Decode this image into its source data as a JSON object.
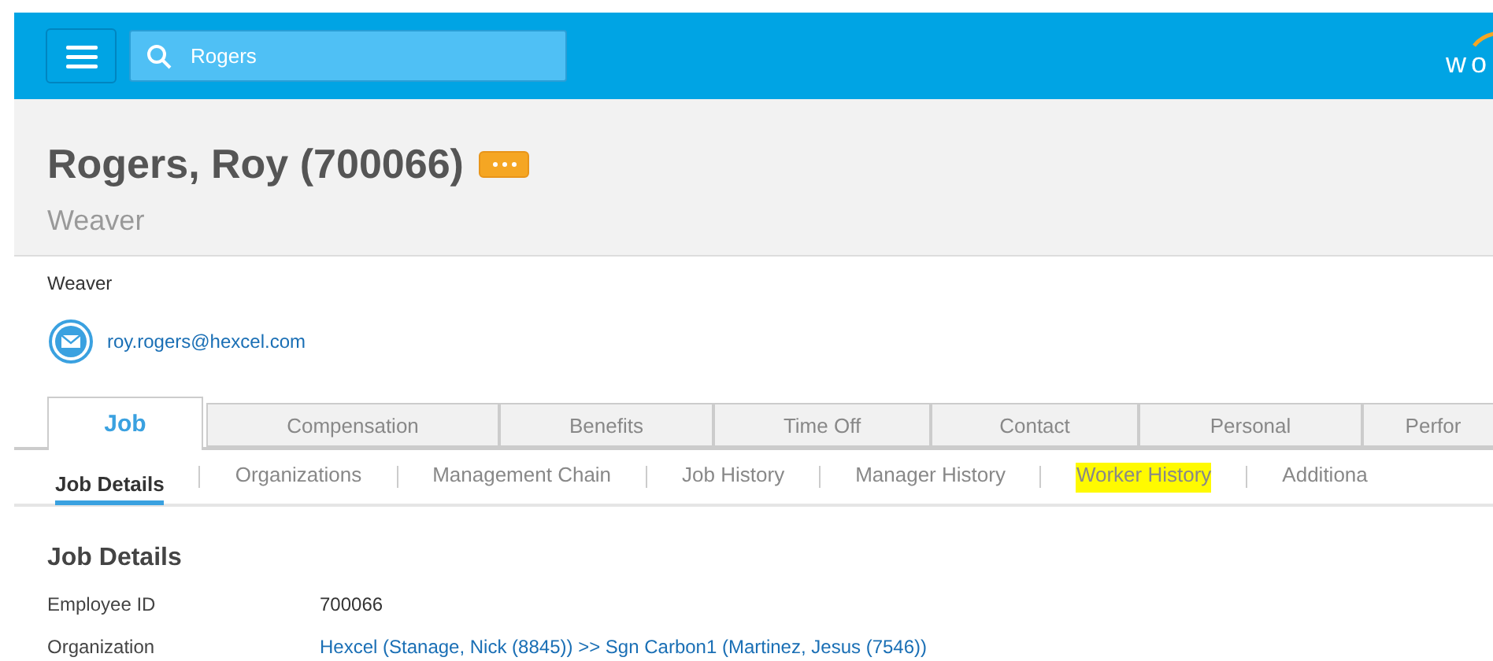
{
  "header": {
    "search": {
      "value": "Rogers"
    },
    "logo": {
      "text": "wo"
    }
  },
  "profile": {
    "name": "Rogers, Roy (700066)",
    "title": "Weaver"
  },
  "summary": {
    "position": "Weaver",
    "email": "roy.rogers@hexcel.com"
  },
  "tabs": [
    {
      "label": "Job",
      "selected": true
    },
    {
      "label": "Compensation",
      "selected": false
    },
    {
      "label": "Benefits",
      "selected": false
    },
    {
      "label": "Time Off",
      "selected": false
    },
    {
      "label": "Contact",
      "selected": false
    },
    {
      "label": "Personal",
      "selected": false
    },
    {
      "label": "Perfor",
      "selected": false
    }
  ],
  "subtabs": [
    {
      "label": "Job Details",
      "selected": true,
      "highlighted": false
    },
    {
      "label": "Organizations",
      "selected": false,
      "highlighted": false
    },
    {
      "label": "Management Chain",
      "selected": false,
      "highlighted": false
    },
    {
      "label": "Job History",
      "selected": false,
      "highlighted": false
    },
    {
      "label": "Manager History",
      "selected": false,
      "highlighted": false
    },
    {
      "label": "Worker History",
      "selected": false,
      "highlighted": true
    },
    {
      "label": "Additiona",
      "selected": false,
      "highlighted": false
    }
  ],
  "section": {
    "title": "Job Details",
    "fields": [
      {
        "label": "Employee ID",
        "value": "700066",
        "kind": "text"
      },
      {
        "label": "Organization",
        "value": "Hexcel (Stanage, Nick (8845)) >> Sgn Carbon1 (Martinez, Jesus (7546))",
        "kind": "link"
      }
    ]
  }
}
